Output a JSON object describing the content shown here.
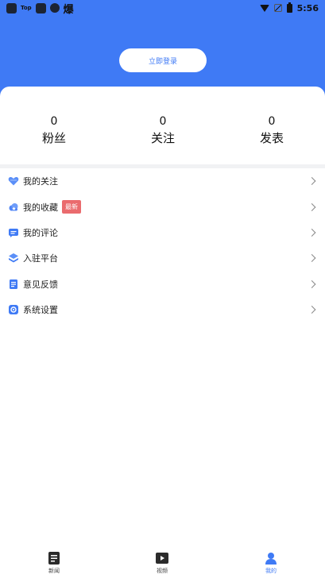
{
  "status_bar": {
    "app_label": "Top",
    "glyph": "爆",
    "time": "5:56"
  },
  "header": {
    "login_button": "立即登录"
  },
  "stats": [
    {
      "value": "0",
      "label": "粉丝"
    },
    {
      "value": "0",
      "label": "关注"
    },
    {
      "value": "0",
      "label": "发表"
    }
  ],
  "menu": {
    "items": [
      {
        "label": "我的关注",
        "icon": "heart-icon"
      },
      {
        "label": "我的收藏",
        "icon": "cloud-icon",
        "badge": "最新"
      },
      {
        "label": "我的评论",
        "icon": "comment-icon"
      },
      {
        "label": "入驻平台",
        "icon": "layers-icon"
      },
      {
        "label": "意见反馈",
        "icon": "feedback-icon"
      },
      {
        "label": "系统设置",
        "icon": "settings-icon"
      }
    ]
  },
  "bottom_nav": {
    "items": [
      {
        "label": "新闻",
        "icon": "news-icon",
        "active": false
      },
      {
        "label": "视频",
        "icon": "video-icon",
        "active": false
      },
      {
        "label": "我的",
        "icon": "profile-icon",
        "active": true
      }
    ]
  },
  "colors": {
    "primary": "#3f7af5",
    "badge": "#ea6b6e",
    "divider": "#f1f2f4"
  }
}
